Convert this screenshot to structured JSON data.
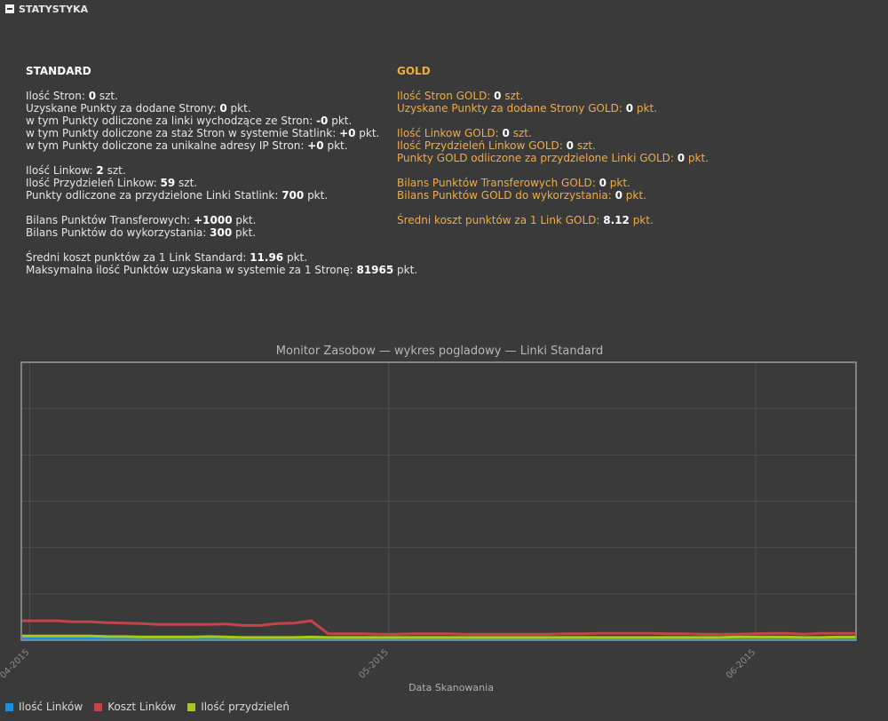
{
  "header": {
    "title": "STATYSTYKA"
  },
  "standard": {
    "title": "STANDARD",
    "lines": [
      [
        {
          "t": "Ilość Stron: "
        },
        {
          "v": "0"
        },
        {
          "t": " szt."
        }
      ],
      [
        {
          "t": "Uzyskane Punkty za dodane Strony: "
        },
        {
          "v": "0"
        },
        {
          "t": " pkt."
        }
      ],
      [
        {
          "t": "w tym Punkty odliczone za linki wychodzące ze Stron: "
        },
        {
          "v": "-0"
        },
        {
          "t": " pkt."
        }
      ],
      [
        {
          "t": "w tym Punkty doliczone za staż Stron w systemie Statlink: "
        },
        {
          "v": "+0"
        },
        {
          "t": " pkt."
        }
      ],
      [
        {
          "t": "w tym Punkty doliczone za unikalne adresy IP Stron: "
        },
        {
          "v": "+0"
        },
        {
          "t": " pkt."
        }
      ],
      "gap",
      [
        {
          "t": "Ilość Linkow: "
        },
        {
          "v": "2"
        },
        {
          "t": " szt."
        }
      ],
      [
        {
          "t": "Ilość Przydzieleń Linkow: "
        },
        {
          "v": "59"
        },
        {
          "t": " szt."
        }
      ],
      [
        {
          "t": "Punkty odliczone za przydzielone Linki Statlink: "
        },
        {
          "v": "700"
        },
        {
          "t": " pkt."
        }
      ],
      "gap",
      [
        {
          "t": "Bilans Punktów Transferowych: "
        },
        {
          "v": "+1000"
        },
        {
          "t": " pkt."
        }
      ],
      [
        {
          "t": "Bilans Punktów do wykorzystania: "
        },
        {
          "v": "300"
        },
        {
          "t": " pkt."
        }
      ],
      "gap",
      [
        {
          "t": "Średni koszt punktów za 1 Link Standard: "
        },
        {
          "v": "11.96"
        },
        {
          "t": " pkt."
        }
      ],
      [
        {
          "t": "Maksymalna ilość Punktów uzyskana w systemie za 1 Stronę: "
        },
        {
          "v": "81965"
        },
        {
          "t": " pkt."
        }
      ]
    ]
  },
  "gold": {
    "title": "GOLD",
    "lines": [
      [
        {
          "t": "Ilość Stron GOLD: "
        },
        {
          "v": "0"
        },
        {
          "t": " szt."
        }
      ],
      [
        {
          "t": "Uzyskane Punkty za dodane Strony GOLD: "
        },
        {
          "v": "0"
        },
        {
          "t": " pkt."
        }
      ],
      "gap",
      [
        {
          "t": "Ilość Linkow GOLD: "
        },
        {
          "v": "0"
        },
        {
          "t": " szt."
        }
      ],
      [
        {
          "t": "Ilość Przydzieleń Linkow GOLD: "
        },
        {
          "v": "0"
        },
        {
          "t": " szt."
        }
      ],
      [
        {
          "t": "Punkty GOLD odliczone za przydzielone Linki GOLD: "
        },
        {
          "v": "0"
        },
        {
          "t": " pkt."
        }
      ],
      "gap",
      [
        {
          "t": "Bilans Punktów Transferowych GOLD: "
        },
        {
          "v": "0"
        },
        {
          "t": " pkt."
        }
      ],
      [
        {
          "t": "Bilans Punktów GOLD do wykorzystania: "
        },
        {
          "v": "0"
        },
        {
          "t": " pkt."
        }
      ],
      "gap",
      [
        {
          "t": "Średni koszt punktów za 1 Link GOLD: "
        },
        {
          "v": "8.12"
        },
        {
          "t": " pkt."
        }
      ]
    ]
  },
  "chart_data": {
    "type": "line",
    "title": "Monitor Zasobow — wykres pogladowy — Linki Standard",
    "xlabel": "Data Skanowania",
    "ylabel": "",
    "x_tick_labels": [
      "04-2015",
      "05-2015",
      "06-2015"
    ],
    "x_tick_fractions": [
      0.01,
      0.44,
      0.88
    ],
    "ylim": [
      0,
      6
    ],
    "grid": true,
    "legend_placement": "bottom-left",
    "series": [
      {
        "name": "Ilość Linków",
        "color": "#1e90d8",
        "values": [
          0.02,
          0.02,
          0.02,
          0.02,
          0.02,
          0.02,
          0.02,
          0.02,
          0.02,
          0.02,
          0.02,
          0.02,
          0.02,
          0.02,
          0.02,
          0.02,
          0.02,
          0.02,
          0.02,
          0.02,
          0.02,
          0.02,
          0.02,
          0.02,
          0.02,
          0.02,
          0.02,
          0.02,
          0.02,
          0.02,
          0.02,
          0.02,
          0.02,
          0.02,
          0.02,
          0.02,
          0.02,
          0.02,
          0.02,
          0.02,
          0.02,
          0.02,
          0.02,
          0.02,
          0.02,
          0.02,
          0.02,
          0.02,
          0.02,
          0.02
        ]
      },
      {
        "name": "Koszt Linków",
        "color": "#c0464a",
        "values": [
          0.4,
          0.4,
          0.4,
          0.38,
          0.38,
          0.36,
          0.35,
          0.34,
          0.32,
          0.32,
          0.32,
          0.32,
          0.33,
          0.3,
          0.3,
          0.34,
          0.35,
          0.4,
          0.12,
          0.12,
          0.12,
          0.11,
          0.11,
          0.12,
          0.12,
          0.12,
          0.11,
          0.11,
          0.11,
          0.11,
          0.11,
          0.11,
          0.12,
          0.12,
          0.13,
          0.13,
          0.13,
          0.13,
          0.12,
          0.12,
          0.11,
          0.11,
          0.11,
          0.12,
          0.13,
          0.13,
          0.11,
          0.13,
          0.13,
          0.13
        ]
      },
      {
        "name": "Ilość przydzieleń",
        "color": "#a8c81c",
        "values": [
          0.07,
          0.07,
          0.07,
          0.07,
          0.07,
          0.06,
          0.06,
          0.05,
          0.05,
          0.05,
          0.05,
          0.06,
          0.05,
          0.04,
          0.04,
          0.04,
          0.04,
          0.05,
          0.04,
          0.04,
          0.04,
          0.04,
          0.04,
          0.04,
          0.04,
          0.04,
          0.04,
          0.04,
          0.04,
          0.04,
          0.04,
          0.04,
          0.04,
          0.04,
          0.04,
          0.04,
          0.04,
          0.04,
          0.04,
          0.04,
          0.04,
          0.04,
          0.05,
          0.05,
          0.05,
          0.05,
          0.04,
          0.04,
          0.05,
          0.05
        ]
      }
    ]
  }
}
